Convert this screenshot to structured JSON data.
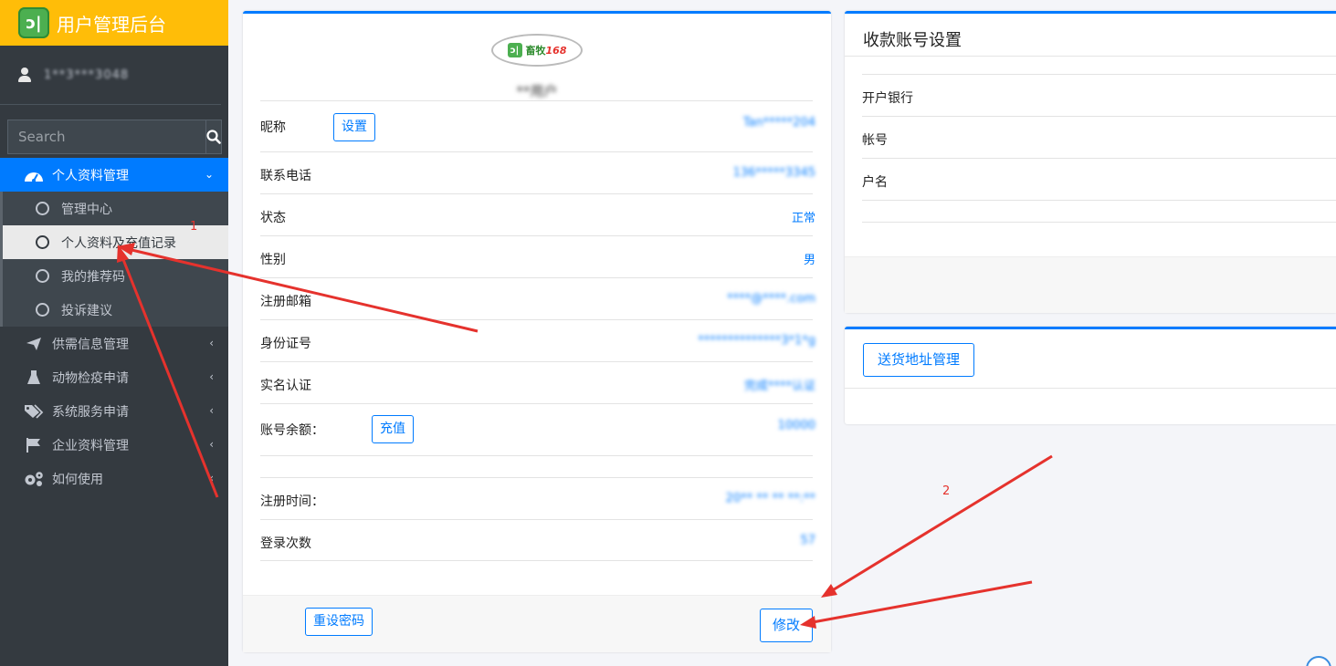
{
  "brand": {
    "title": "用户管理后台",
    "logo_text": "ↄ|"
  },
  "user": {
    "name": "1**3***3048"
  },
  "search": {
    "placeholder": "Search"
  },
  "nav": {
    "profile": {
      "label": "个人资料管理"
    },
    "sub": [
      {
        "label": "管理中心"
      },
      {
        "label": "个人资料及充值记录"
      },
      {
        "label": "我的推荐码"
      },
      {
        "label": "投诉建议"
      }
    ],
    "items": [
      {
        "label": "供需信息管理",
        "icon": "paper-plane-icon"
      },
      {
        "label": "动物检疫申请",
        "icon": "flask-icon"
      },
      {
        "label": "系统服务申请",
        "icon": "tags-icon"
      },
      {
        "label": "企业资料管理",
        "icon": "flag-icon"
      },
      {
        "label": "如何使用",
        "icon": "cogs-icon"
      }
    ]
  },
  "profile": {
    "logo": {
      "word": "畜牧",
      "num": "168"
    },
    "name": "**用户",
    "rows": [
      {
        "label": "昵称",
        "button": "设置",
        "value": "Tan*****204"
      },
      {
        "label": "联系电话",
        "value": "136*****3345"
      },
      {
        "label": "状态",
        "value": "正常"
      },
      {
        "label": "性别",
        "value": "男"
      },
      {
        "label": "注册邮箱",
        "value": "****@****.com"
      },
      {
        "label": "身份证号",
        "value": "**************3*1*g"
      },
      {
        "label": "实名认证",
        "value": "完成****认证"
      },
      {
        "label": "账号余额：",
        "button": "充值",
        "value": "10000"
      },
      {
        "label": "注册时间：",
        "value": "20** ** ** **:**"
      },
      {
        "label": "登录次数",
        "value": "57"
      }
    ],
    "reset_password": "重设密码",
    "modify": "修改"
  },
  "account_settings": {
    "title": "收款账号设置",
    "rows": [
      {
        "label": "开户银行"
      },
      {
        "label": "帐号"
      },
      {
        "label": "户名"
      }
    ]
  },
  "address": {
    "button": "送货地址管理"
  },
  "annotations": {
    "one": "1",
    "two": "2"
  },
  "colors": {
    "primary": "#007bff",
    "sidebar": "#343a40",
    "brand": "#ffbd08",
    "arrow": "#e5322d"
  }
}
